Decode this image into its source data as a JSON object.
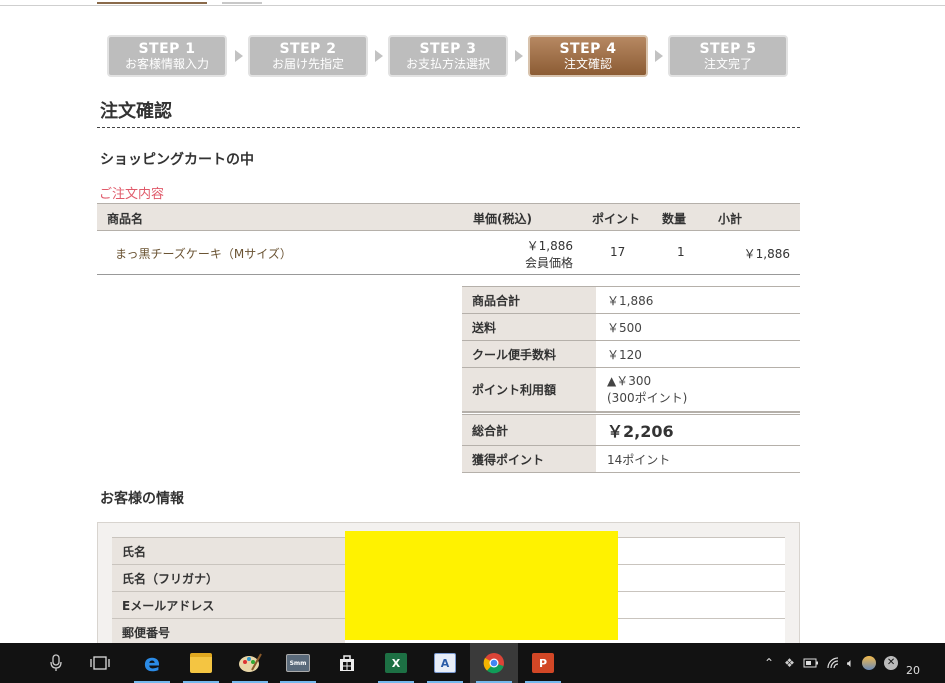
{
  "steps": [
    {
      "num": "STEP 1",
      "label": "お客様情報入力",
      "active": false
    },
    {
      "num": "STEP 2",
      "label": "お届け先指定",
      "active": false
    },
    {
      "num": "STEP 3",
      "label": "お支払方法選択",
      "active": false
    },
    {
      "num": "STEP 4",
      "label": "注文確認",
      "active": true
    },
    {
      "num": "STEP 5",
      "label": "注文完了",
      "active": false
    }
  ],
  "page": {
    "title": "注文確認",
    "cart_heading": "ショッピングカートの中",
    "order_heading": "ご注文内容",
    "customer_heading": "お客様の情報"
  },
  "cart": {
    "headers": {
      "name": "商品名",
      "price": "単価(税込)",
      "points": "ポイント",
      "qty": "数量",
      "subtotal": "小計"
    },
    "items": [
      {
        "name": "まっ黒チーズケーキ（Mサイズ）",
        "price": "￥1,886",
        "price_note": "会員価格",
        "points": "17",
        "qty": "1",
        "subtotal": "￥1,886"
      }
    ]
  },
  "totals": {
    "goods_label": "商品合計",
    "goods_value": "￥1,886",
    "shipping_label": "送料",
    "shipping_value": "￥500",
    "cool_label": "クール便手数料",
    "cool_value": "￥120",
    "points_used_label": "ポイント利用額",
    "points_used_value": "▲￥300",
    "points_used_note": "(300ポイント)",
    "grand_label": "総合計",
    "grand_value": "￥2,206",
    "earned_label": "獲得ポイント",
    "earned_value": "14ポイント"
  },
  "customer": {
    "rows": [
      "氏名",
      "氏名（フリガナ）",
      "Eメールアドレス",
      "郵便番号"
    ]
  },
  "taskbar": {
    "apps": [
      "microphone-icon",
      "task-view-icon",
      "edge-icon",
      "file-explorer-icon",
      "paint-icon",
      "app-icon",
      "store-icon",
      "excel-icon",
      "access-icon",
      "chrome-icon",
      "powerpoint-icon"
    ],
    "tray_clock_partial": "20"
  },
  "colors": {
    "step_active": "#9a6a42",
    "step_inactive": "#bdbdbd",
    "order_heading": "#e05a6a",
    "table_header_bg": "#e9e4df",
    "redaction": "#fff200"
  }
}
